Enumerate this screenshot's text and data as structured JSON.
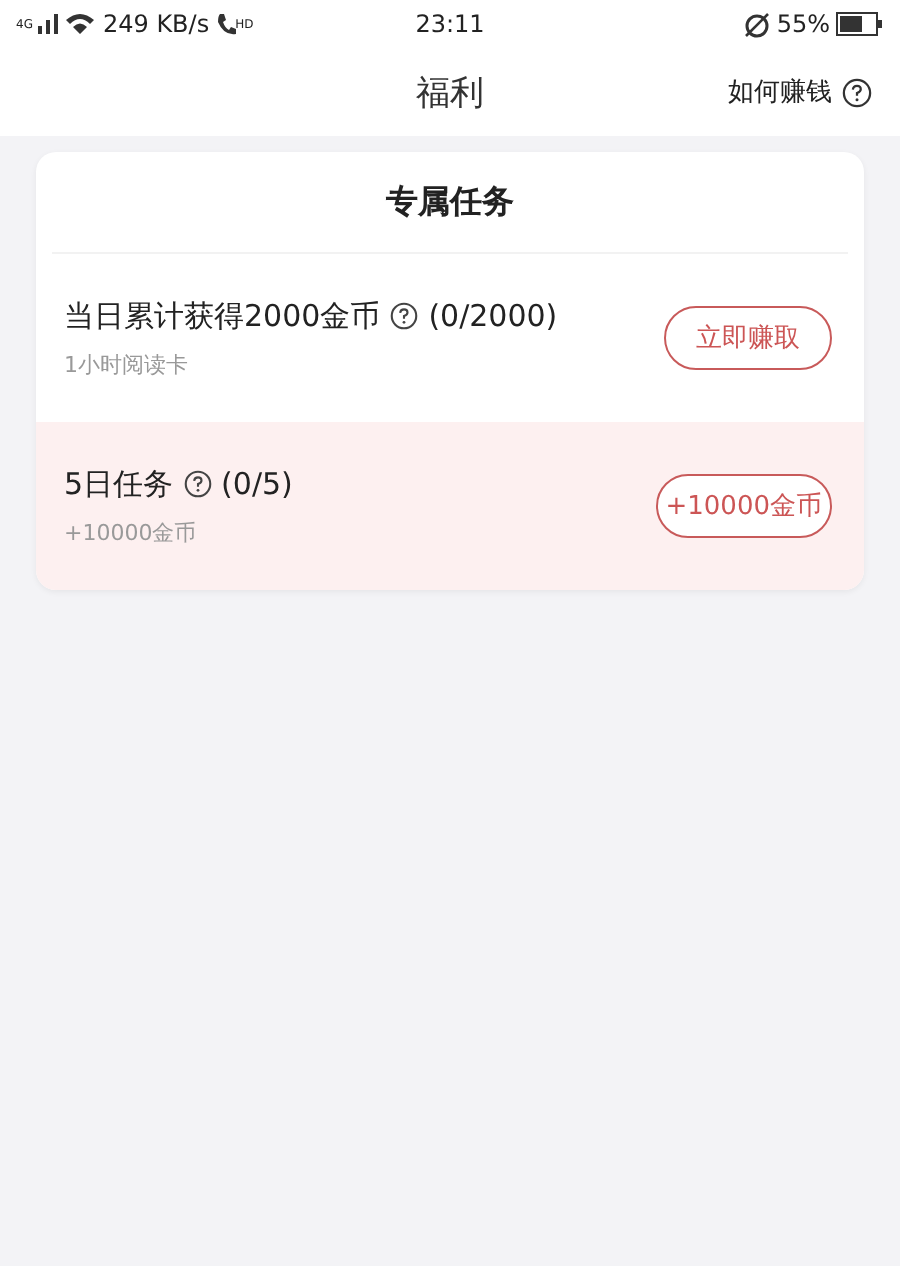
{
  "status_bar": {
    "network": "4G",
    "speed": "249 KB/s",
    "call_badge": "HD",
    "time": "23:11",
    "battery": "55%"
  },
  "header": {
    "title": "福利",
    "help_link": "如何赚钱"
  },
  "section": {
    "title": "专属任务",
    "tasks": [
      {
        "title": "当日累计获得2000金币",
        "progress": "(0/2000)",
        "subtitle": "1小时阅读卡",
        "button": "立即赚取",
        "highlighted": false
      },
      {
        "title": "5日任务",
        "progress": "(0/5)",
        "subtitle": "+10000金币",
        "button": "+10000金币",
        "highlighted": true
      }
    ]
  }
}
